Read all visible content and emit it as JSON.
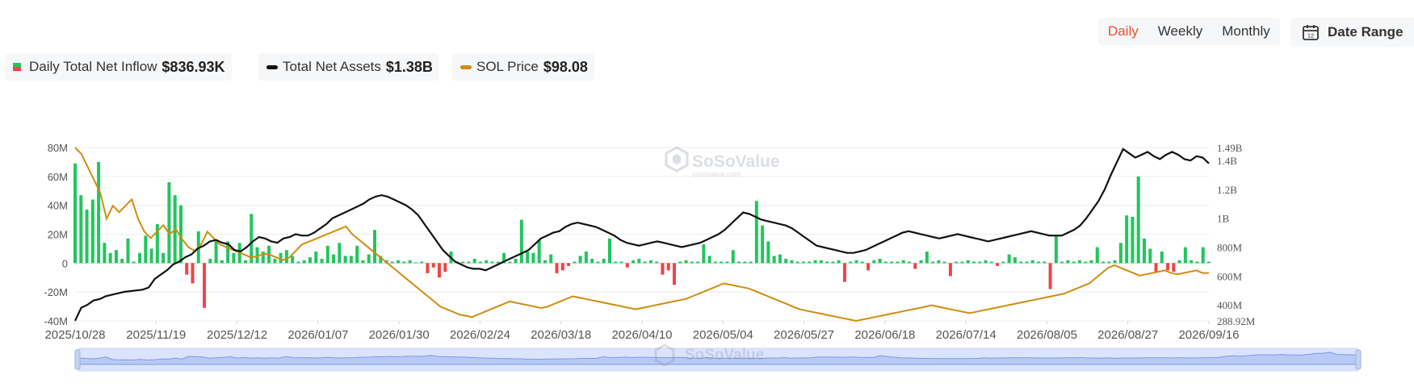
{
  "toolbar": {
    "periods": [
      {
        "label": "Daily",
        "active": true
      },
      {
        "label": "Weekly",
        "active": false
      },
      {
        "label": "Monthly",
        "active": false
      }
    ],
    "date_range_label": "Date Range",
    "date_range_icon": "calendar-icon",
    "calendar_day": "12"
  },
  "legend": {
    "inflow": {
      "label": "Daily Total Net Inflow",
      "value": "$836.93K",
      "color": "#22c55e",
      "negative_color": "#ef4444"
    },
    "assets": {
      "label": "Total Net Assets",
      "value": "$1.38B",
      "color": "#111111"
    },
    "sol": {
      "label": "SOL Price",
      "value": "$98.08",
      "color": "#d08c10"
    }
  },
  "watermark": {
    "text": "SoSoValue",
    "subtext": "sosovalue.com"
  },
  "chart_data": {
    "type": "bar+line",
    "x_ticks": [
      "2025/10/28",
      "2025/11/19",
      "2025/12/12",
      "2026/01/07",
      "2026/01/30",
      "2026/02/24",
      "2026/03/18",
      "2026/04/10",
      "2026/05/04",
      "2026/05/27",
      "2026/06/18",
      "2026/07/14",
      "2026/08/05",
      "2026/08/27",
      "2026/09/16"
    ],
    "y_left": {
      "ticks": [
        "80M",
        "60M",
        "40M",
        "20M",
        "0",
        "-20M",
        "-40M"
      ],
      "values": [
        80,
        60,
        40,
        20,
        0,
        -20,
        -40
      ],
      "unit": "M USD",
      "range": [
        -40,
        80
      ]
    },
    "y_right": {
      "ticks": [
        "1.49B",
        "1.4B",
        "1.2B",
        "1B",
        "800M",
        "600M",
        "400M",
        "288.92M"
      ],
      "values": [
        1490,
        1400,
        1200,
        1000,
        800,
        600,
        400,
        288.92
      ],
      "unit": "M USD",
      "range": [
        288.92,
        1490
      ]
    },
    "series": [
      {
        "name": "Daily Total Net Inflow",
        "kind": "bar",
        "axis": "left",
        "unit": "M USD",
        "values": [
          69,
          47,
          37,
          44,
          70,
          14,
          7,
          9,
          3,
          17,
          1,
          7,
          19,
          10,
          27,
          7,
          56,
          47,
          40,
          -8,
          -14,
          22,
          -31,
          3,
          16,
          2,
          15,
          7,
          14,
          2,
          34,
          11,
          8,
          12,
          3,
          7,
          9,
          5,
          1,
          2,
          4,
          8,
          3,
          12,
          6,
          14,
          5,
          5,
          12,
          2,
          6,
          23,
          5,
          2,
          1,
          2,
          1,
          2,
          0.5,
          1,
          -7,
          -3,
          -10,
          -6,
          8,
          1,
          1,
          1,
          3,
          1,
          2,
          1,
          1,
          7,
          1,
          3,
          30,
          8,
          7,
          16,
          2,
          6,
          -7,
          -5,
          -2,
          1,
          5,
          8,
          3,
          1,
          3,
          17,
          1,
          1,
          -3,
          2,
          3,
          1,
          2,
          1,
          -8,
          -5,
          -15,
          1,
          2,
          1,
          1,
          13,
          5,
          1,
          1,
          1,
          9,
          1,
          1,
          1,
          43,
          26,
          15,
          5,
          6,
          3,
          2,
          1,
          1,
          1,
          2,
          2,
          1,
          1,
          2,
          -13,
          1,
          2,
          1,
          -5,
          2,
          3,
          1,
          1,
          1,
          2,
          1,
          -4,
          2,
          8,
          1,
          2,
          1,
          -9,
          1,
          1,
          2,
          1,
          1,
          2,
          1,
          -2,
          1,
          6,
          4,
          1,
          1,
          2,
          1,
          1,
          -18,
          19,
          1,
          2,
          1,
          2,
          1,
          2,
          11,
          1,
          1,
          2,
          14,
          33,
          32,
          60,
          17,
          10,
          -6,
          8,
          -5,
          -6,
          2,
          11,
          2,
          1,
          11,
          1
        ]
      },
      {
        "name": "Total Net Assets",
        "kind": "line",
        "axis": "right",
        "unit": "M USD",
        "values": [
          290,
          380,
          400,
          430,
          440,
          460,
          470,
          480,
          490,
          495,
          500,
          505,
          520,
          580,
          610,
          640,
          680,
          700,
          730,
          750,
          790,
          810,
          840,
          850,
          830,
          820,
          780,
          770,
          800,
          840,
          870,
          860,
          840,
          830,
          860,
          870,
          890,
          880,
          880,
          900,
          930,
          960,
          1000,
          1020,
          1040,
          1060,
          1080,
          1100,
          1130,
          1150,
          1160,
          1150,
          1130,
          1110,
          1090,
          1060,
          1020,
          960,
          900,
          840,
          780,
          740,
          700,
          680,
          660,
          650,
          650,
          640,
          660,
          680,
          700,
          720,
          740,
          760,
          780,
          820,
          860,
          880,
          900,
          910,
          940,
          960,
          970,
          960,
          950,
          940,
          920,
          900,
          880,
          850,
          830,
          820,
          810,
          820,
          830,
          840,
          830,
          820,
          810,
          800,
          810,
          820,
          830,
          850,
          870,
          890,
          920,
          960,
          1000,
          1040,
          1030,
          1010,
          990,
          980,
          970,
          960,
          950,
          930,
          900,
          870,
          840,
          810,
          800,
          790,
          780,
          770,
          760,
          760,
          770,
          780,
          800,
          820,
          840,
          860,
          880,
          900,
          910,
          900,
          890,
          880,
          870,
          860,
          870,
          880,
          890,
          880,
          870,
          860,
          850,
          840,
          850,
          860,
          870,
          880,
          890,
          900,
          910,
          900,
          890,
          880,
          880,
          880,
          900,
          920,
          950,
          1000,
          1060,
          1120,
          1200,
          1300,
          1390,
          1480,
          1450,
          1420,
          1440,
          1460,
          1430,
          1410,
          1440,
          1460,
          1440,
          1410,
          1400,
          1430,
          1420,
          1380
        ]
      },
      {
        "name": "SOL Price",
        "kind": "line",
        "axis": "right",
        "unit": "USD",
        "values": [
          195,
          190,
          180,
          170,
          160,
          140,
          150,
          145,
          150,
          155,
          140,
          130,
          125,
          130,
          135,
          128,
          132,
          124,
          118,
          115,
          120,
          130,
          125,
          120,
          118,
          116,
          114,
          112,
          110,
          111,
          113,
          112,
          110,
          108,
          110,
          115,
          120,
          122,
          124,
          126,
          128,
          130,
          132,
          134,
          128,
          124,
          120,
          116,
          112,
          108,
          104,
          100,
          96,
          92,
          88,
          84,
          80,
          76,
          72,
          70,
          68,
          66,
          65,
          64,
          66,
          68,
          70,
          72,
          74,
          76,
          75,
          74,
          73,
          72,
          71,
          72,
          74,
          76,
          78,
          80,
          79,
          78,
          77,
          76,
          75,
          74,
          73,
          72,
          71,
          70,
          71,
          72,
          73,
          74,
          75,
          76,
          77,
          78,
          80,
          82,
          84,
          86,
          88,
          90,
          89,
          88,
          87,
          86,
          84,
          82,
          80,
          78,
          76,
          74,
          72,
          70,
          69,
          68,
          67,
          66,
          65,
          64,
          63,
          62,
          61,
          62,
          63,
          64,
          65,
          66,
          67,
          68,
          69,
          70,
          71,
          72,
          73,
          72,
          71,
          70,
          69,
          68,
          67,
          68,
          69,
          70,
          71,
          72,
          73,
          74,
          75,
          76,
          77,
          78,
          79,
          80,
          81,
          82,
          84,
          86,
          88,
          90,
          94,
          98,
          102,
          104,
          102,
          100,
          98,
          96,
          97,
          98,
          99,
          100,
          98,
          97,
          98,
          99,
          100,
          98,
          98
        ]
      }
    ],
    "title": "",
    "grid": true,
    "legend_position": "top-left"
  }
}
